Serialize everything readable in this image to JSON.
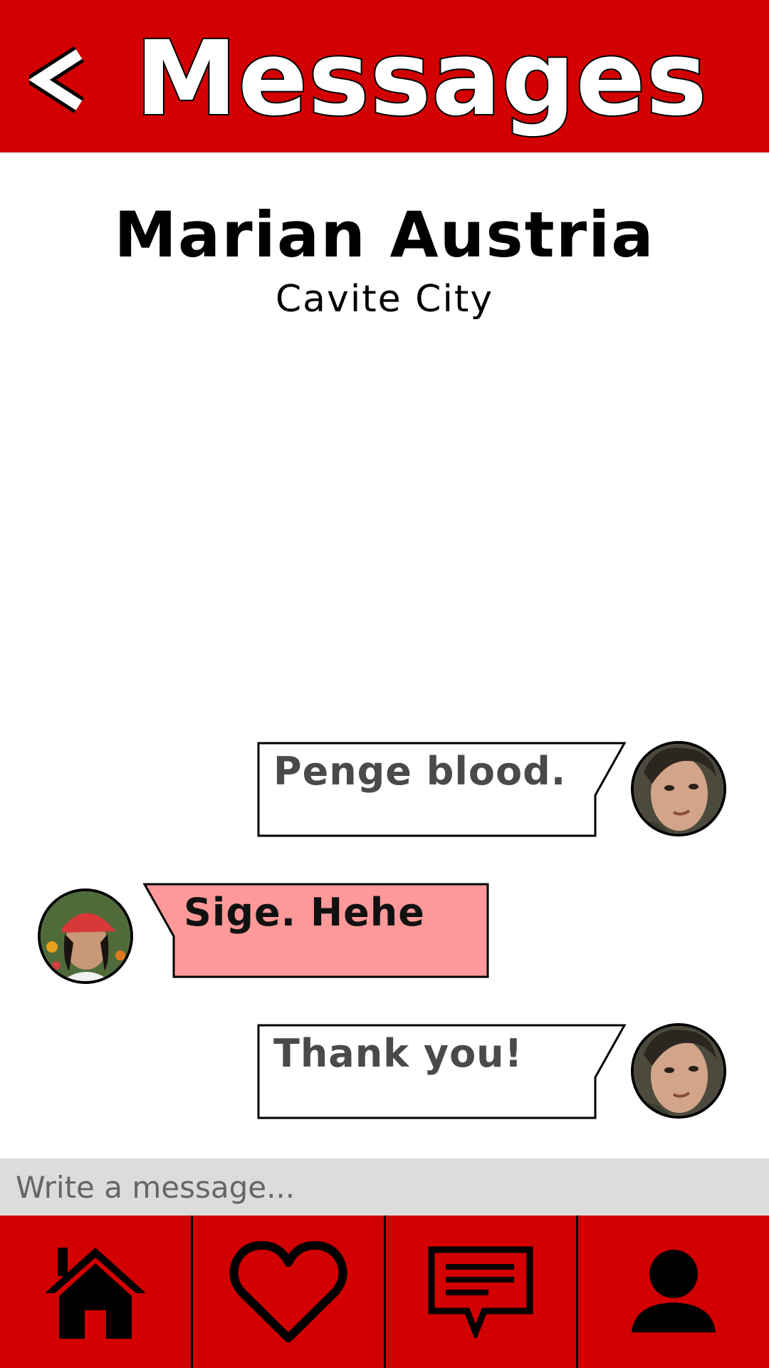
{
  "header": {
    "back_label": "<",
    "title": "Messages"
  },
  "contact": {
    "name": "Marian Austria",
    "city": "Cavite City"
  },
  "messages": [
    {
      "direction": "sent",
      "text": "Penge blood.",
      "avatar": "male-user-avatar"
    },
    {
      "direction": "received",
      "text": "Sige. Hehe",
      "avatar": "marian-avatar"
    },
    {
      "direction": "sent",
      "text": "Thank you!",
      "avatar": "male-user-avatar"
    }
  ],
  "composer": {
    "placeholder": "Write a message..."
  },
  "nav": [
    {
      "icon": "home-icon"
    },
    {
      "icon": "heart-icon"
    },
    {
      "icon": "chat-icon"
    },
    {
      "icon": "profile-icon"
    }
  ],
  "colors": {
    "brand_red": "#d20000",
    "received_bubble": "#ff9999",
    "composer_bg": "#dcdcdc"
  }
}
